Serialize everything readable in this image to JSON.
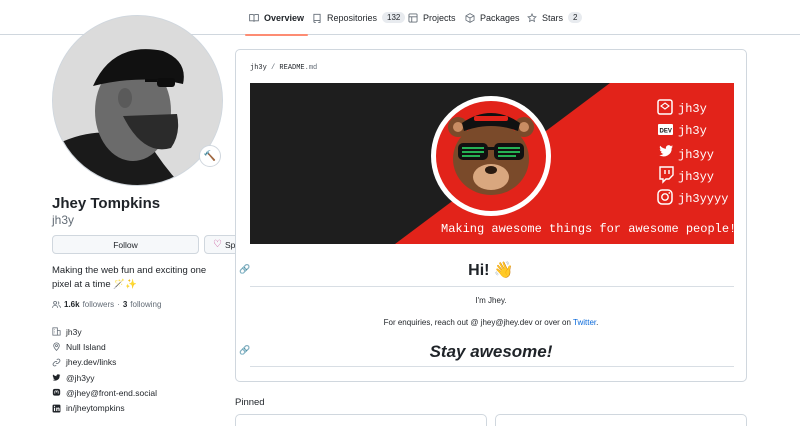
{
  "tabs": [
    {
      "label": "Overview",
      "icon": "book-icon",
      "active": true
    },
    {
      "label": "Repositories",
      "icon": "repo-icon",
      "count": "132"
    },
    {
      "label": "Projects",
      "icon": "table-icon"
    },
    {
      "label": "Packages",
      "icon": "package-icon"
    },
    {
      "label": "Stars",
      "icon": "star-icon",
      "count": "2"
    }
  ],
  "profile": {
    "name": "Jhey Tompkins",
    "login": "jh3y",
    "follow_label": "Follow",
    "sponsor_label": "Sponsor",
    "bio": "Making the web fun and exciting one pixel at a time 🪄✨",
    "followers_count": "1.6k",
    "followers_label": "followers",
    "separator": "·",
    "following_count": "3",
    "following_label": "following",
    "details": [
      {
        "icon": "organization-icon",
        "text": "jh3y"
      },
      {
        "icon": "location-icon",
        "text": "Null Island"
      },
      {
        "icon": "link-icon",
        "text": "jhey.dev/links"
      },
      {
        "icon": "twitter-icon",
        "text": "@jh3yy"
      },
      {
        "icon": "mastodon-icon",
        "text": "@jhey@front-end.social"
      },
      {
        "icon": "linkedin-icon",
        "text": "in/jheytompkins"
      }
    ]
  },
  "readme": {
    "path_user": "jh3y",
    "path_sep": "/",
    "path_file": "README",
    "path_ext": ".md",
    "banner": {
      "handles": [
        {
          "icon": "codepen-icon",
          "text": "jh3y"
        },
        {
          "icon": "dev-icon",
          "text": "jh3y"
        },
        {
          "icon": "twitter-icon",
          "text": "jh3yy"
        },
        {
          "icon": "twitch-icon",
          "text": "jh3yy"
        },
        {
          "icon": "instagram-icon",
          "text": "jh3yyyy"
        }
      ],
      "tagline": "Making awesome things for awesome people!",
      "colors": {
        "dark": "#1e1e1e",
        "red": "#e2231a"
      }
    },
    "heading": "Hi! 👋",
    "intro": "I'm Jhey.",
    "contact_prefix": "For enquiries, reach out @ jhey@jhey.dev or over on",
    "contact_link": "Twitter",
    "contact_suffix": ".",
    "closing": "Stay awesome!"
  },
  "pinned_label": "Pinned",
  "colors": {
    "accent_underline": "#fd8c73",
    "link": "#0969da",
    "border": "#d0d7de"
  }
}
